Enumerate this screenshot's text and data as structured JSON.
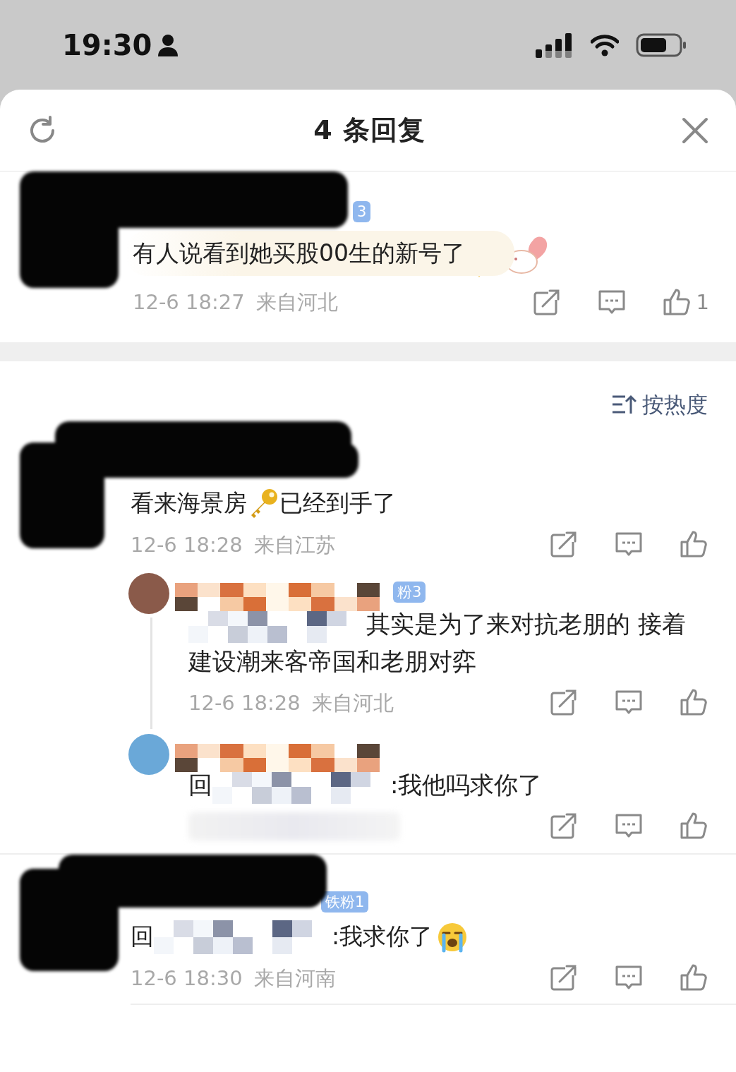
{
  "status_bar": {
    "time": "19:30"
  },
  "header": {
    "title": "4 条回复"
  },
  "root_comment": {
    "badge": "3",
    "segments": [
      {
        "kind": "text",
        "text": "有人说看到她买股00生的新号了"
      }
    ],
    "date": "12-6 18:27",
    "location": "来自河北",
    "like_count": "1"
  },
  "sort": {
    "label": "按热度"
  },
  "replies": [
    {
      "kind": "top",
      "segments": [
        {
          "kind": "text",
          "text": "看来海景房"
        },
        {
          "kind": "key"
        },
        {
          "kind": "text",
          "text": "已经到手了"
        }
      ],
      "date": "12-6 18:28",
      "location": "来自江苏"
    },
    {
      "kind": "sub",
      "badge": "粉3",
      "segments": [
        {
          "kind": "mosaic"
        },
        {
          "kind": "text",
          "text": "其实是为了来对抗老朋的 接着建设潮来客帝国和老朋对弈"
        }
      ],
      "date": "12-6 18:28",
      "location": "来自河北"
    },
    {
      "kind": "sub",
      "segments": [
        {
          "kind": "text",
          "text": "回"
        },
        {
          "kind": "mosaic"
        },
        {
          "kind": "text",
          "text": ":我他吗求你了"
        }
      ]
    },
    {
      "kind": "top",
      "badge": "铁粉1",
      "segments": [
        {
          "kind": "text",
          "text": "回"
        },
        {
          "kind": "mosaic"
        },
        {
          "kind": "text",
          "text": ":我求你了"
        },
        {
          "kind": "crying"
        }
      ],
      "date": "12-6 18:30",
      "location": "来自河南"
    }
  ]
}
